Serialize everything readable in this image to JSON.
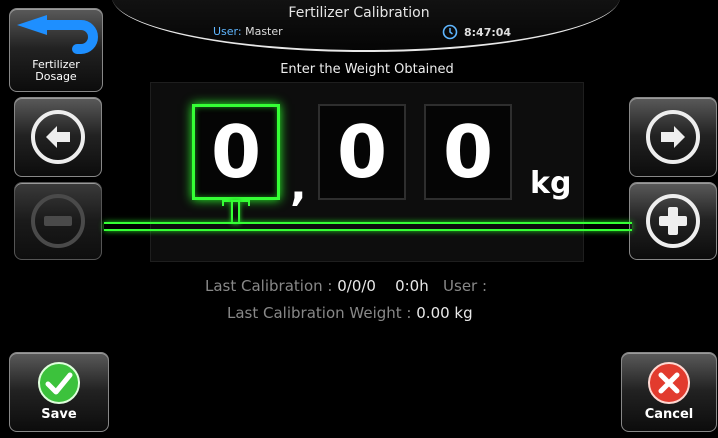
{
  "header": {
    "title": "Fertilizer Calibration",
    "user_label": "User:",
    "user_name": "Master",
    "time": "8:47:04"
  },
  "back_button": {
    "label_line1": "Fertilizer",
    "label_line2": "Dosage"
  },
  "prompt": "Enter the Weight Obtained",
  "weight_entry": {
    "digits": [
      "0",
      "0",
      "0"
    ],
    "separator": ",",
    "unit": "kg",
    "active_digit": 1
  },
  "info": {
    "last_calibration_label": "Last Calibration :",
    "last_calibration_date": "0/0/0",
    "last_calibration_time": "0:0h",
    "user_label": "User :",
    "last_weight_label": "Last Calibration Weight :",
    "last_weight_value": "0.00 kg"
  },
  "save_button": {
    "label": "Save"
  },
  "cancel_button": {
    "label": "Cancel"
  },
  "colors": {
    "accent_green": "#35ff35",
    "user_label_blue": "#5fb6ff",
    "back_arrow_blue": "#1e8fff",
    "cancel_red": "#e23b2e",
    "save_green": "#3cc23c"
  }
}
